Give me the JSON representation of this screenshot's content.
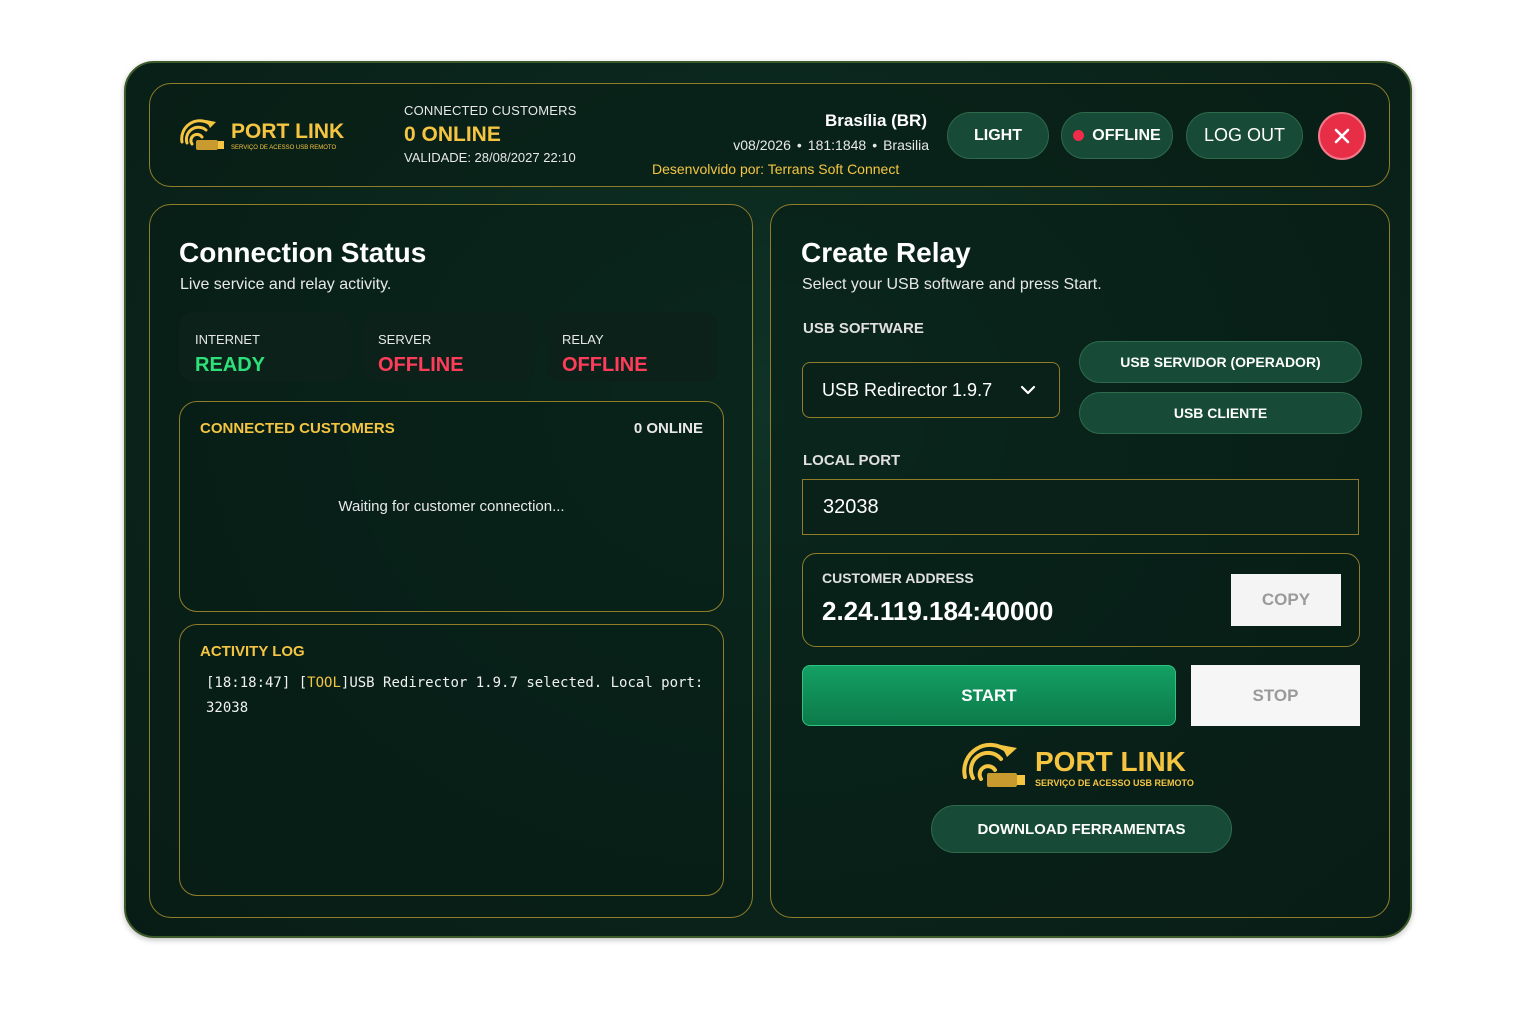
{
  "colors": {
    "accent_gold": "#f5c542",
    "ready_green": "#2ee07a",
    "offline_red": "#ff3d5a",
    "button_green": "#174a37",
    "start_green": "#14a064",
    "close_red": "#e82e47"
  },
  "brand": {
    "name": "PORT LINK",
    "tagline_small": "SERVIÇO DE ACESSO USB REMOTO",
    "tagline_big": "SERVIÇO DE ACESSO USB REMOTO"
  },
  "header": {
    "customers_label": "CONNECTED CUSTOMERS",
    "customers_value": "0 ONLINE",
    "validade": "VALIDADE: 28/08/2027 22:10",
    "city": "Brasília (BR)",
    "version": "v08/2026",
    "server_code": "181:1848",
    "location": "Brasilia",
    "developer": "Desenvolvido por: Terrans Soft Connect",
    "light_label": "LIGHT",
    "offline_label": "OFFLINE",
    "logout_label": "LOG OUT",
    "close_icon": "close-icon"
  },
  "connection": {
    "title": "Connection Status",
    "subtitle": "Live service and relay activity.",
    "tiles": [
      {
        "label": "INTERNET",
        "value": "READY",
        "color": "#2ee07a"
      },
      {
        "label": "SERVER",
        "value": "OFFLINE",
        "color": "#ff3d5a"
      },
      {
        "label": "RELAY",
        "value": "OFFLINE",
        "color": "#ff3d5a"
      }
    ],
    "customers_box": {
      "title": "CONNECTED CUSTOMERS",
      "count": "0 ONLINE",
      "waiting": "Waiting for customer connection..."
    },
    "activity_log": {
      "title": "ACTIVITY LOG",
      "time": "[18:18:47]",
      "tag_open": " [",
      "tag": "TOOL",
      "tag_close": "]",
      "message": "USB Redirector 1.9.7 selected. Local port: 32038"
    }
  },
  "relay": {
    "title": "Create Relay",
    "subtitle": "Select your USB software and press Start.",
    "usb_software_label": "USB SOFTWARE",
    "usb_software_value": "USB Redirector 1.9.7",
    "usb_servidor_label": "USB SERVIDOR (OPERADOR)",
    "usb_cliente_label": "USB CLIENTE",
    "local_port_label": "LOCAL PORT",
    "local_port_value": "32038",
    "customer_address_label": "CUSTOMER ADDRESS",
    "customer_address_value": "2.24.119.184:40000",
    "copy_label": "COPY",
    "start_label": "START",
    "stop_label": "STOP",
    "download_label": "DOWNLOAD FERRAMENTAS"
  }
}
